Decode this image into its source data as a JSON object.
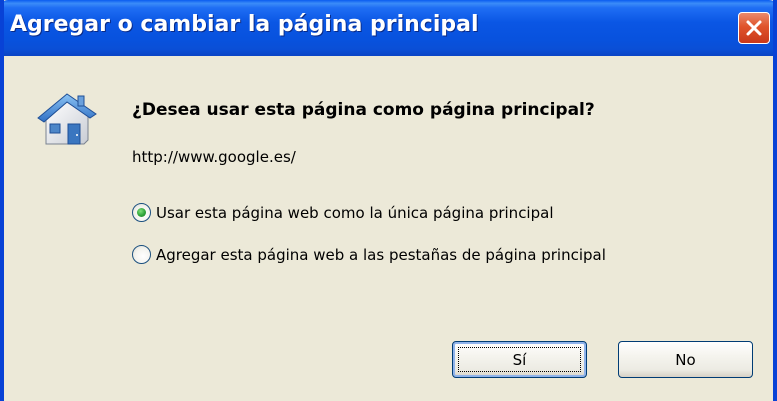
{
  "window": {
    "title": "Agregar o cambiar la página principal",
    "accent_color": "#0a56e4",
    "close_color": "#e0542b"
  },
  "dialog": {
    "icon": "house-icon",
    "question": "¿Desea usar esta página como página principal?",
    "url": "http://www.google.es/",
    "options": [
      {
        "label": "Usar esta página web como la única página principal",
        "checked": true
      },
      {
        "label": "Agregar esta página web a las pestañas de página principal",
        "checked": false
      }
    ]
  },
  "buttons": {
    "yes_label": "Sí",
    "no_label": "No"
  }
}
